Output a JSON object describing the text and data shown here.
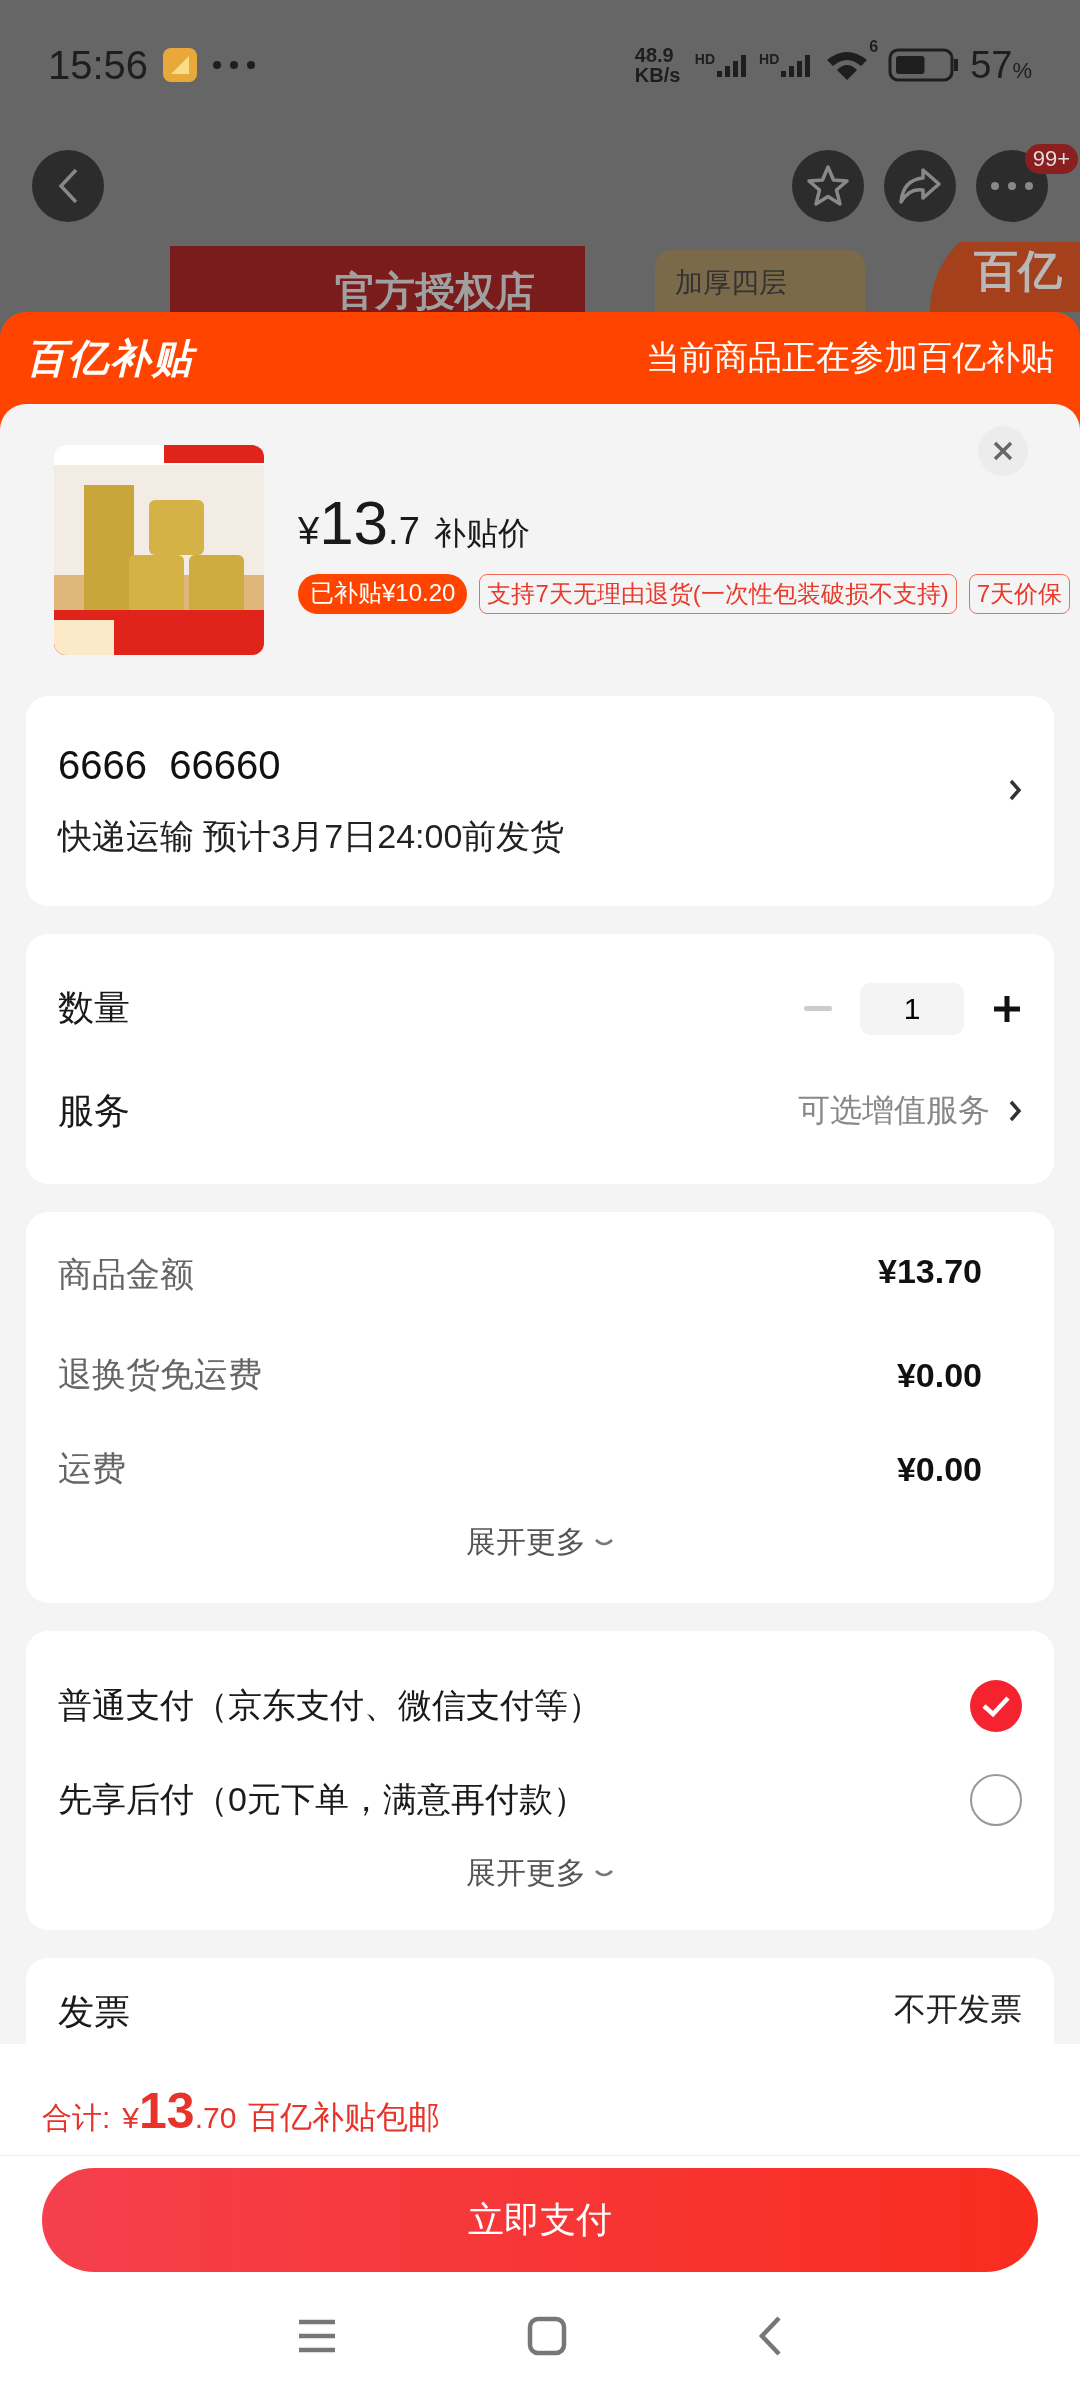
{
  "status_bar": {
    "time": "15:56",
    "speed": "48.9 KB/s",
    "battery": "57",
    "battery_unit": "%",
    "signal_labels": [
      "HD",
      "HD"
    ],
    "wifi_label": "6"
  },
  "nav": {
    "badge": "99+"
  },
  "backdrop": {
    "banner": "官方授权店",
    "tag": "加厚四层",
    "badge": "百亿"
  },
  "sheet_header": {
    "logo": "百亿补贴",
    "note": "当前商品正在参加百亿补贴"
  },
  "product": {
    "kind": "picture",
    "currency": "¥",
    "price_int": "13",
    "price_dec": ".7",
    "price_label": "补贴价",
    "tags": [
      {
        "text": "已补贴¥10.20",
        "kind": "filled"
      },
      {
        "text": "支持7天无理由退货(一次性包装破损不支持)",
        "kind": "outline"
      },
      {
        "text": "7天价保",
        "kind": "outline"
      }
    ]
  },
  "address": {
    "line": "6666  66660",
    "shipping": "快递运输 预计3月7日24:00前发货"
  },
  "quantity": {
    "label": "数量",
    "value": "1",
    "minus_disabled": true
  },
  "service": {
    "label": "服务",
    "value": "可选增值服务"
  },
  "fees": {
    "rows": [
      {
        "label": "商品金额",
        "value": "¥13.70"
      },
      {
        "label": "退换货免运费",
        "value": "¥0.00"
      },
      {
        "label": "运费",
        "value": "¥0.00"
      }
    ],
    "more": "展开更多"
  },
  "payments": {
    "options": [
      {
        "label": "普通支付（京东支付、微信支付等）",
        "selected": true
      },
      {
        "label": "先享后付（0元下单，满意再付款）",
        "selected": false
      }
    ],
    "more": "展开更多"
  },
  "invoice": {
    "label": "发票",
    "value": "不开发票"
  },
  "total": {
    "label": "合计:",
    "currency": "¥",
    "int": "13",
    "dec": ".70",
    "note": "百亿补贴包邮"
  },
  "pay_button": "立即支付"
}
